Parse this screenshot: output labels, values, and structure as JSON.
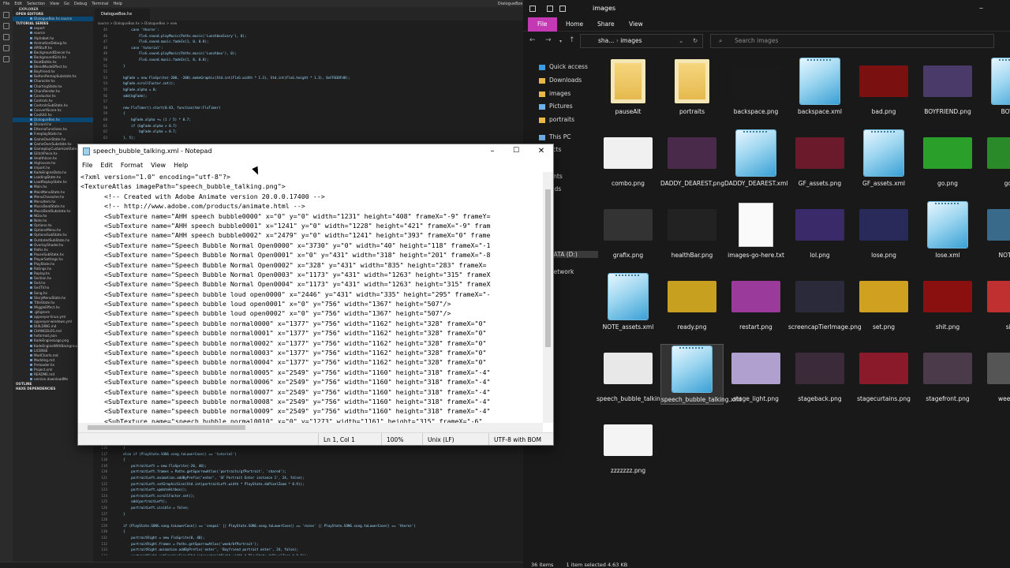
{
  "vscode": {
    "menu": [
      "File",
      "Edit",
      "Selection",
      "View",
      "Go",
      "Debug",
      "Terminal",
      "Help"
    ],
    "window_title": "DialogueBox.hx - TUTORIAL",
    "sidebar_header": "EXPLORER",
    "open_editors_label": "OPEN EDITORS",
    "open_editor_item": "DialogueBox.hx source",
    "project_label": "TUTORIAL SERIES",
    "files": [
      "export",
      "source",
      "Alphabet.hx",
      "AnimationDebug.hx",
      "APIStuff.hx",
      "BackgroundDancer.hx",
      "BackgroundGirls.hx",
      "BeatBattle.hx",
      "BlendModeEffect.hx",
      "Boyfriend.hx",
      "ButtonRemapSubstate.hx",
      "Character.hx",
      "ChartingState.hx",
      "CharsRender.hx",
      "Conductor.hx",
      "Controls.hx",
      "ControlsSubState.hx",
      "ConvertScore.hx",
      "CoolUtil.hx",
      "DialogueBox.hx",
      "Discord.hx",
      "EtternaFunctions.hx",
      "FreeplayState.hx",
      "GameOverState.hx",
      "GameOverSubstate.hx",
      "GameplayCustomizeState.hx",
      "GlitchPiece.hx",
      "HealthIcon.hx",
      "Highscore.hx",
      "import.hx",
      "KadeEngineData.hx",
      "LoadingState.hx",
      "LoadReplayState.hx",
      "Main.hx",
      "MainMenuState.hx",
      "MenuCharacter.hx",
      "MenuItem.hx",
      "MusicBeatState.hx",
      "MusicBeatSubstate.hx",
      "NGio.hx",
      "Note.hx",
      "Options.hx",
      "OptionsMenu.hx",
      "OptionsSubState.hx",
      "OutdatedSubState.hx",
      "OverlayShader.hx",
      "Paths.hx",
      "PauseSubState.hx",
      "PlayerSettings.hx",
      "PlayState.hx",
      "Ratings.hx",
      "Replay.hx",
      "Section.hx",
      "Snd.hx",
      "SndTV.hx",
      "Song.hx",
      "StoryMenuState.hx",
      "TitleState.hx",
      "WiggleEffect.hx",
      ".gitignore",
      "appveyor-linux.yml",
      "appveyor-windows.yml",
      "BUILDING.md",
      "CHANGELOG.md",
      "hxformat.json",
      "KadeEngineLogo.png",
      "KadeEngineWithBackground.png",
      "LICENSE",
      "ModCharts.md",
      "Modding.md",
      "Preloader.hx",
      "Project.xml",
      "README.md",
      "version.downloadMe"
    ],
    "outline_label": "OUTLINE",
    "npm_label": "HAXE DEPENDENCIES",
    "tab_label": "DialogueBox.hx",
    "breadcrumb": "source > DialogueBox.hx > DialogueBox > new",
    "code_top": [
      {
        "n": "45",
        "t": "        case 'thorns':"
      },
      {
        "n": "46",
        "t": "            FlxG.sound.playMusic(Paths.music('LunchboxScary'), 0);"
      },
      {
        "n": "47",
        "t": "            FlxG.sound.music.fadeIn(1, 0, 0.8);"
      },
      {
        "n": "48",
        "t": "        case 'tutorial':"
      },
      {
        "n": "49",
        "t": "            FlxG.sound.playMusic(Paths.music('Lunchbox'), 0);"
      },
      {
        "n": "50",
        "t": "            FlxG.sound.music.fadeIn(1, 0, 0.8);"
      },
      {
        "n": "51",
        "t": "    }"
      },
      {
        "n": "52",
        "t": ""
      },
      {
        "n": "53",
        "t": "    bgFade = new FlxSprite(-200, -200).makeGraphic(Std.int(FlxG.width * 1.3), Std.int(FlxG.height * 1.3), 0xFFB3DFd8);"
      },
      {
        "n": "54",
        "t": "    bgFade.scrollFactor.set();"
      },
      {
        "n": "55",
        "t": "    bgFade.alpha = 0;"
      },
      {
        "n": "56",
        "t": "    add(bgFade);"
      },
      {
        "n": "57",
        "t": ""
      },
      {
        "n": "58",
        "t": "    new FlxTimer().start(0.83, function(tmr:FlxTimer)"
      },
      {
        "n": "59",
        "t": "    {"
      },
      {
        "n": "60",
        "t": "        bgFade.alpha += (1 / 5) * 0.7;"
      },
      {
        "n": "61",
        "t": "        if (bgFade.alpha > 0.7)"
      },
      {
        "n": "62",
        "t": "            bgFade.alpha = 0.7;"
      },
      {
        "n": "63",
        "t": "    }, 5);"
      }
    ],
    "code_bottom": [
      {
        "n": "116",
        "t": "    }"
      },
      {
        "n": "117",
        "t": "    else if (PlayState.SONG.song.toLowerCase() == 'tutorial')"
      },
      {
        "n": "118",
        "t": "    {"
      },
      {
        "n": "119",
        "t": "        portraitLeft = new FlxSprite(-20, 40);"
      },
      {
        "n": "120",
        "t": "        portraitLeft.frames = Paths.getSparrowAtlas('portraits/gfPortrait', 'shared');"
      },
      {
        "n": "121",
        "t": "        portraitLeft.animation.addByPrefix('enter', 'GF Portrait Enter instance 1', 24, false);"
      },
      {
        "n": "122",
        "t": "        portraitLeft.setGraphicSize(Std.int(portraitLeft.width * PlayState.daPixelZoom * 0.9));"
      },
      {
        "n": "123",
        "t": "        portraitLeft.updateHitbox();"
      },
      {
        "n": "124",
        "t": "        portraitLeft.scrollFactor.set();"
      },
      {
        "n": "125",
        "t": "        add(portraitLeft);"
      },
      {
        "n": "126",
        "t": "        portraitLeft.visible = false;"
      },
      {
        "n": "127",
        "t": "    }"
      },
      {
        "n": "128",
        "t": ""
      },
      {
        "n": "129",
        "t": "    if (PlayState.SONG.song.toLowerCase() == 'senpai' || PlayState.SONG.song.toLowerCase() == 'roses' || PlayState.SONG.song.toLowerCase() == 'thorns')"
      },
      {
        "n": "130",
        "t": "    {"
      },
      {
        "n": "131",
        "t": "        portraitRight = new FlxSprite(0, 40);"
      },
      {
        "n": "132",
        "t": "        portraitRight.frames = Paths.getSparrowAtlas('weeb/bfPortrait');"
      },
      {
        "n": "133",
        "t": "        portraitRight.animation.addByPrefix('enter', 'Boyfriend portrait enter', 24, false);"
      },
      {
        "n": "134",
        "t": "        portraitRight.setGraphicSize(Std.int(portraitRight.width * PlayState.daPixelZoom * 0.9));"
      },
      {
        "n": "135",
        "t": "        portraitRight.updateHitbox();"
      }
    ]
  },
  "explorer": {
    "title": "images",
    "ribbon": [
      "File",
      "Home",
      "Share",
      "View"
    ],
    "address": [
      "sha...",
      "images"
    ],
    "search_placeholder": "Search images",
    "nav": [
      {
        "label": "Quick access",
        "icon": "star-icon"
      },
      {
        "label": "Downloads",
        "icon": "folder-icon"
      },
      {
        "label": "images",
        "icon": "folder-icon"
      },
      {
        "label": "Pictures",
        "icon": "pictures-icon"
      },
      {
        "label": "portraits",
        "icon": "folder-icon"
      },
      {
        "label": "This PC",
        "icon": "pc-icon"
      },
      {
        "label": "3D Objects",
        "icon": "folder-icon"
      },
      {
        "label": "Desktop",
        "icon": "folder-icon"
      },
      {
        "label": "Documents",
        "icon": "folder-icon"
      },
      {
        "label": "Downloads",
        "icon": "folder-icon"
      },
      {
        "label": "Music",
        "icon": "folder-icon"
      },
      {
        "label": "Pictures",
        "icon": "folder-icon"
      },
      {
        "label": "Videos",
        "icon": "folder-icon"
      },
      {
        "label": "OS (C:)",
        "icon": "drive-icon"
      },
      {
        "label": "DATA (D:)",
        "icon": "drive-icon"
      },
      {
        "label": "Network",
        "icon": "network-icon"
      }
    ],
    "files": [
      {
        "label": "pauseAlt",
        "kind": "folder"
      },
      {
        "label": "portraits",
        "kind": "folder"
      },
      {
        "label": "backspace.png",
        "kind": "image",
        "color": "#1a1a1a"
      },
      {
        "label": "backspace.xml",
        "kind": "xml"
      },
      {
        "label": "bad.png",
        "kind": "image",
        "color": "#7a1010"
      },
      {
        "label": "BOYFRIEND.png",
        "kind": "image",
        "color": "#4a3a6a"
      },
      {
        "label": "BOYFRI",
        "kind": "xml"
      },
      {
        "label": "combo.png",
        "kind": "image",
        "color": "#f0f0f0"
      },
      {
        "label": "DADDY_DEAREST.png",
        "kind": "image",
        "color": "#4a2a4a"
      },
      {
        "label": "DADDY_DEAREST.xml",
        "kind": "xml"
      },
      {
        "label": "GF_assets.png",
        "kind": "image",
        "color": "#6a1a2a"
      },
      {
        "label": "GF_assets.xml",
        "kind": "xml"
      },
      {
        "label": "go.png",
        "kind": "image",
        "color": "#2aa02a"
      },
      {
        "label": "good",
        "kind": "image",
        "color": "#2a8a2a"
      },
      {
        "label": "grafix.png",
        "kind": "image",
        "color": "#333333"
      },
      {
        "label": "healthBar.png",
        "kind": "image",
        "color": "#222222"
      },
      {
        "label": "images-go-here.txt",
        "kind": "txt"
      },
      {
        "label": "lol.png",
        "kind": "image",
        "color": "#3a2a6a"
      },
      {
        "label": "lose.png",
        "kind": "image",
        "color": "#2a2a5a"
      },
      {
        "label": "lose.xml",
        "kind": "xml"
      },
      {
        "label": "NOTE_as",
        "kind": "image",
        "color": "#3a6a8a"
      },
      {
        "label": "NOTE_assets.xml",
        "kind": "xml"
      },
      {
        "label": "ready.png",
        "kind": "image",
        "color": "#c8a020"
      },
      {
        "label": "restart.png",
        "kind": "image",
        "color": "#9a3a9a"
      },
      {
        "label": "screencapTierImage.png",
        "kind": "image",
        "color": "#2a2a3a"
      },
      {
        "label": "set.png",
        "kind": "image",
        "color": "#d0a020"
      },
      {
        "label": "shit.png",
        "kind": "image",
        "color": "#8a1010"
      },
      {
        "label": "sick",
        "kind": "image",
        "color": "#c03030"
      },
      {
        "label": "speech_bubble_talking.png",
        "kind": "image",
        "color": "#e8e8e8"
      },
      {
        "label": "speech_bubble_talking.xml",
        "kind": "xml",
        "selected": true
      },
      {
        "label": "stage_light.png",
        "kind": "image",
        "color": "#b0a0d0"
      },
      {
        "label": "stageback.png",
        "kind": "image",
        "color": "#3a2a3a"
      },
      {
        "label": "stagecurtains.png",
        "kind": "image",
        "color": "#8a1a2a"
      },
      {
        "label": "stagefront.png",
        "kind": "image",
        "color": "#4a3a4a"
      },
      {
        "label": "week54p",
        "kind": "image",
        "color": "#555555"
      },
      {
        "label": "zzzzzzz.png",
        "kind": "image",
        "color": "#f4f4f4"
      }
    ],
    "status_items": "36 items",
    "status_selected": "1 item selected  4.63 KB"
  },
  "notepad": {
    "title": "speech_bubble_talking.xml - Notepad",
    "menu": [
      "File",
      "Edit",
      "Format",
      "View",
      "Help"
    ],
    "lines": [
      "<?xml version=\"1.0\" encoding=\"utf-8\"?>",
      "<TextureAtlas imagePath=\"speech_bubble_talking.png\">",
      "      <!-- Created with Adobe Animate version 20.0.0.17400 -->",
      "      <!-- http://www.adobe.com/products/animate.html -->",
      "      <SubTexture name=\"AHH speech bubble0000\" x=\"0\" y=\"0\" width=\"1231\" height=\"408\" frameX=\"-9\" frameY=",
      "      <SubTexture name=\"AHH speech bubble0001\" x=\"1241\" y=\"0\" width=\"1228\" height=\"421\" frameX=\"-9\" fram",
      "      <SubTexture name=\"AHH speech bubble0002\" x=\"2479\" y=\"0\" width=\"1241\" height=\"393\" frameX=\"0\" frame",
      "      <SubTexture name=\"Speech Bubble Normal Open0000\" x=\"3730\" y=\"0\" width=\"40\" height=\"118\" frameX=\"-1",
      "      <SubTexture name=\"Speech Bubble Normal Open0001\" x=\"0\" y=\"431\" width=\"318\" height=\"201\" frameX=\"-8",
      "      <SubTexture name=\"Speech Bubble Normal Open0002\" x=\"328\" y=\"431\" width=\"835\" height=\"283\" frameX=",
      "      <SubTexture name=\"Speech Bubble Normal Open0003\" x=\"1173\" y=\"431\" width=\"1263\" height=\"315\" frameX",
      "      <SubTexture name=\"Speech Bubble Normal Open0004\" x=\"1173\" y=\"431\" width=\"1263\" height=\"315\" frameX",
      "      <SubTexture name=\"speech bubble loud open0000\" x=\"2446\" y=\"431\" width=\"335\" height=\"295\" frameX=\"-",
      "      <SubTexture name=\"speech bubble loud open0001\" x=\"0\" y=\"756\" width=\"1367\" height=\"507\"/>",
      "      <SubTexture name=\"speech bubble loud open0002\" x=\"0\" y=\"756\" width=\"1367\" height=\"507\"/>",
      "      <SubTexture name=\"speech bubble normal0000\" x=\"1377\" y=\"756\" width=\"1162\" height=\"328\" frameX=\"0\"",
      "      <SubTexture name=\"speech bubble normal0001\" x=\"1377\" y=\"756\" width=\"1162\" height=\"328\" frameX=\"0\"",
      "      <SubTexture name=\"speech bubble normal0002\" x=\"1377\" y=\"756\" width=\"1162\" height=\"328\" frameX=\"0\"",
      "      <SubTexture name=\"speech bubble normal0003\" x=\"1377\" y=\"756\" width=\"1162\" height=\"328\" frameX=\"0\"",
      "      <SubTexture name=\"speech bubble normal0004\" x=\"1377\" y=\"756\" width=\"1162\" height=\"328\" frameX=\"0\"",
      "      <SubTexture name=\"speech bubble normal0005\" x=\"2549\" y=\"756\" width=\"1160\" height=\"318\" frameX=\"-4\"",
      "      <SubTexture name=\"speech bubble normal0006\" x=\"2549\" y=\"756\" width=\"1160\" height=\"318\" frameX=\"-4\"",
      "      <SubTexture name=\"speech bubble normal0007\" x=\"2549\" y=\"756\" width=\"1160\" height=\"318\" frameX=\"-4\"",
      "      <SubTexture name=\"speech bubble normal0008\" x=\"2549\" y=\"756\" width=\"1160\" height=\"318\" frameX=\"-4\"",
      "      <SubTexture name=\"speech bubble normal0009\" x=\"2549\" y=\"756\" width=\"1160\" height=\"318\" frameX=\"-4\"",
      "      <SubTexture name=\"speech bubble normal0010\" x=\"0\" y=\"1273\" width=\"1161\" height=\"315\" frameX=\"-6\""
    ],
    "status": {
      "position": "Ln 1, Col 1",
      "zoom": "100%",
      "eol": "Unix (LF)",
      "encoding": "UTF-8 with BOM"
    }
  },
  "colors": {
    "accent": "#c239b3",
    "vscode_bg": "#1e1e1e",
    "explorer_bg": "#191919",
    "selection": "#094771"
  }
}
